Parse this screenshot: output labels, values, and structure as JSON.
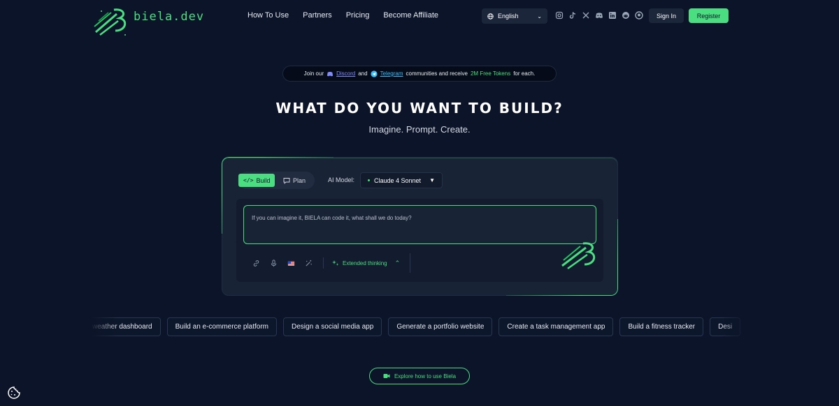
{
  "brand": {
    "name": "biela.dev",
    "accent": "#4ade80",
    "background": "#0b1428"
  },
  "nav": {
    "items": [
      "How To Use",
      "Partners",
      "Pricing",
      "Become Affiliate"
    ]
  },
  "language": {
    "selected": "English",
    "icon": "globe-icon"
  },
  "socials": [
    "instagram-icon",
    "tiktok-icon",
    "x-icon",
    "discord-icon",
    "linkedin-icon",
    "reddit-icon",
    "github-icon"
  ],
  "auth": {
    "sign_in": "Sign In",
    "register": "Register"
  },
  "announcement": {
    "prefix": "Join our",
    "discord": "Discord",
    "and": "and",
    "telegram": "Telegram",
    "middle": "communities and receive",
    "tokens": "2M Free Tokens",
    "suffix": "for each."
  },
  "hero": {
    "title": "WHAT DO YOU WANT TO BUILD?",
    "subtitle": "Imagine. Prompt. Create."
  },
  "composer": {
    "modes": {
      "build": "Build",
      "plan": "Plan",
      "active": "Build"
    },
    "model_label": "AI Model:",
    "model": "Claude 4 Sonnet",
    "placeholder": "If you can imagine it, BIELA can code it, what shall we do today?",
    "tools": [
      "link-icon",
      "microphone-icon",
      "flag-us-icon",
      "magic-wand-icon"
    ],
    "extended_thinking": "Extended thinking"
  },
  "suggestions": [
    "weather dashboard",
    "Build an e-commerce platform",
    "Design a social media app",
    "Generate a portfolio website",
    "Create a task management app",
    "Build a fitness tracker",
    "Desi"
  ],
  "explore": "Explore how to use Biela"
}
